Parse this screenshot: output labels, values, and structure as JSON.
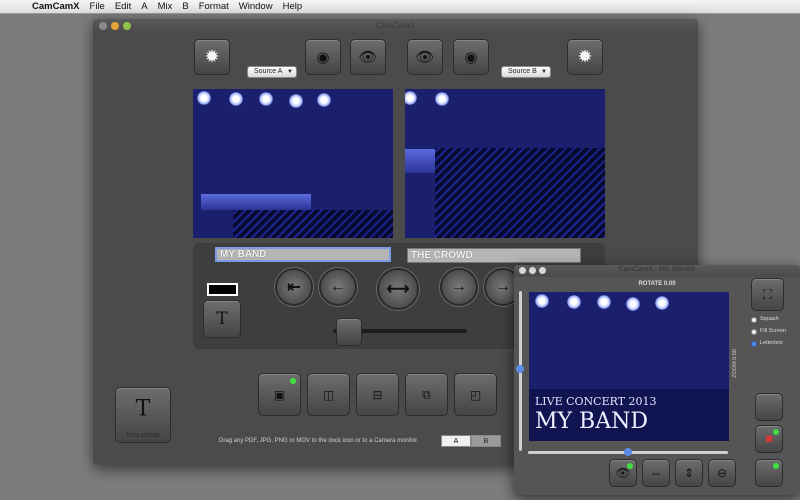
{
  "menubar": {
    "app": "CamCamX",
    "items": [
      "File",
      "Edit",
      "A",
      "Mix",
      "B",
      "Format",
      "Window",
      "Help"
    ]
  },
  "main_window": {
    "title": "CamCamX",
    "source_a": "Source A",
    "source_b": "Source B",
    "title_a": "MY BAND",
    "title_b": "THE CROWD",
    "title_editor_label": "TITLE EDITOR",
    "drop_hint": "Drag any PDF, JPG, PNG or MOV to the dock icon or to a Camera monitor.",
    "toggle_a": "A",
    "toggle_b": "B",
    "crossfade_level": 0.12
  },
  "mix_monitor": {
    "title": "CamCamX - Mix Monitor",
    "rotate": "ROTATE 0.00",
    "zoom": "ZOOM 0.50",
    "overlay_subtitle": "LIVE CONCERT 2013",
    "overlay_title": "MY BAND",
    "scale_options": [
      "Squash",
      "Fill Screen",
      "Letterbox"
    ],
    "selected_option": "Letterbox"
  },
  "colors": {
    "window_bg": "#4b4b4b",
    "panel_bg": "#3e3e3e",
    "selection": "#7a9ce6",
    "active_dot": "#3fe03f",
    "video_tint": "#1a1f6e"
  },
  "icons": {
    "brightness": "sun-icon",
    "camera": "camera-icon",
    "eye": "eye-icon",
    "first": "skip-back-icon",
    "back": "arrow-left-icon",
    "swap": "swap-icon",
    "forward": "arrow-right-icon",
    "title": "title-t-icon"
  }
}
